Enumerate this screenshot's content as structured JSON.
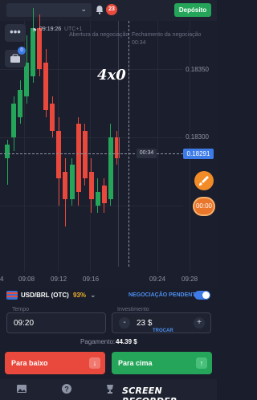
{
  "topbar": {
    "balance": "",
    "notification_count": "23",
    "deposit_label": "Depósito"
  },
  "chart": {
    "start_time": "09:19:26",
    "start_sub": "UTC+1",
    "open_label": "Abertura da negociação",
    "close_label": "Fechamento da negociação",
    "close_time": "00:34",
    "countdown": "00:34",
    "current_price": "0.18291",
    "price_ticks": [
      "0.18350",
      "0.18300"
    ],
    "time_ticks": [
      "09:08",
      "09:12",
      "09:16",
      "09:24",
      "09:28"
    ],
    "watermark": "4x0",
    "timer_button": "00:00"
  },
  "chart_data": {
    "type": "candlestick",
    "price_axis_ticks": [
      0.1835,
      0.183
    ],
    "time_axis_ticks": [
      "09:08",
      "09:12",
      "09:16",
      "09:24",
      "09:28"
    ],
    "current_price": 0.18291,
    "candles": [
      {
        "direction": "up",
        "open": 0.18285,
        "close": 0.18295,
        "high": 0.18298,
        "low": 0.18265
      },
      {
        "direction": "up",
        "open": 0.183,
        "close": 0.18325,
        "high": 0.1833,
        "low": 0.1829
      },
      {
        "direction": "up",
        "open": 0.18315,
        "close": 0.18335,
        "high": 0.18342,
        "low": 0.1831
      },
      {
        "direction": "up",
        "open": 0.1833,
        "close": 0.18355,
        "high": 0.18375,
        "low": 0.18325
      },
      {
        "direction": "up",
        "open": 0.18345,
        "close": 0.1838,
        "high": 0.18395,
        "low": 0.1834
      },
      {
        "direction": "down",
        "open": 0.1838,
        "close": 0.1835,
        "high": 0.1839,
        "low": 0.18345
      },
      {
        "direction": "down",
        "open": 0.18355,
        "close": 0.1832,
        "high": 0.18365,
        "low": 0.18315
      },
      {
        "direction": "down",
        "open": 0.18325,
        "close": 0.18305,
        "high": 0.1833,
        "low": 0.183
      },
      {
        "direction": "down",
        "open": 0.18305,
        "close": 0.1827,
        "high": 0.18315,
        "low": 0.1825
      },
      {
        "direction": "down",
        "open": 0.18275,
        "close": 0.18255,
        "high": 0.18285,
        "low": 0.18235
      },
      {
        "direction": "up",
        "open": 0.18255,
        "close": 0.1828,
        "high": 0.18285,
        "low": 0.1825
      },
      {
        "direction": "down",
        "open": 0.1831,
        "close": 0.1826,
        "high": 0.18315,
        "low": 0.1825
      },
      {
        "direction": "down",
        "open": 0.18305,
        "close": 0.1827,
        "high": 0.1831,
        "low": 0.18265
      },
      {
        "direction": "down",
        "open": 0.18275,
        "close": 0.18255,
        "high": 0.18285,
        "low": 0.18245
      },
      {
        "direction": "up",
        "open": 0.1825,
        "close": 0.1826,
        "high": 0.1827,
        "low": 0.18245
      },
      {
        "direction": "down",
        "open": 0.18265,
        "close": 0.18252,
        "high": 0.1827,
        "low": 0.18245
      },
      {
        "direction": "up",
        "open": 0.18255,
        "close": 0.183,
        "high": 0.1831,
        "low": 0.1825
      },
      {
        "direction": "down",
        "open": 0.183,
        "close": 0.18285,
        "high": 0.18305,
        "low": 0.1828
      }
    ]
  },
  "asset": {
    "name": "USD/BRL (OTC)",
    "payout_pct": "93%",
    "pending_label": "NEGOCIAÇÃO PENDENTE"
  },
  "form": {
    "time_label": "Tempo",
    "time_value": "09:20",
    "investment_label": "Investimento",
    "investment_value": "23 $",
    "minus": "-",
    "plus": "+",
    "trocar": "TROCAR",
    "payout_label": "Pagamento:",
    "payout_value": "44.39 $"
  },
  "buttons": {
    "down_label": "Para baixo",
    "up_label": "Para cima",
    "down_icon": "↓",
    "up_icon": "↑"
  },
  "nav": {
    "recorder": "SCREEN RECORDER"
  },
  "colors": {
    "up": "#25a55a",
    "down": "#e9483c",
    "accent": "#3d7be8",
    "background": "#1a1d2b"
  }
}
